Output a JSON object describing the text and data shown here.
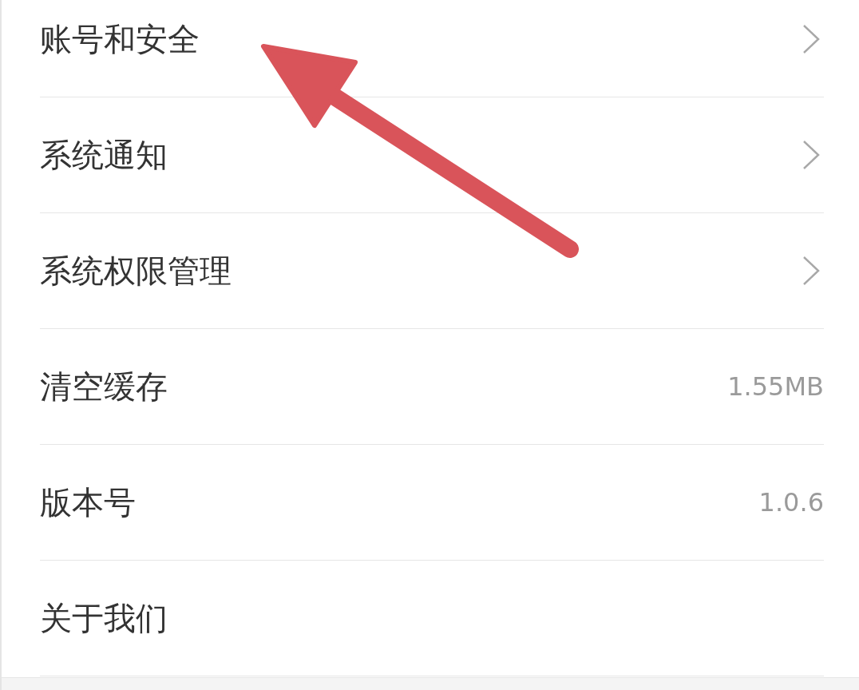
{
  "settings": [
    {
      "kind": "link",
      "label": "账号和安全"
    },
    {
      "kind": "link",
      "label": "系统通知"
    },
    {
      "kind": "link",
      "label": "系统权限管理"
    },
    {
      "kind": "value",
      "label": "清空缓存",
      "value": "1.55MB"
    },
    {
      "kind": "value",
      "label": "版本号",
      "value": "1.0.6"
    },
    {
      "kind": "link_plain",
      "label": "关于我们"
    }
  ]
}
